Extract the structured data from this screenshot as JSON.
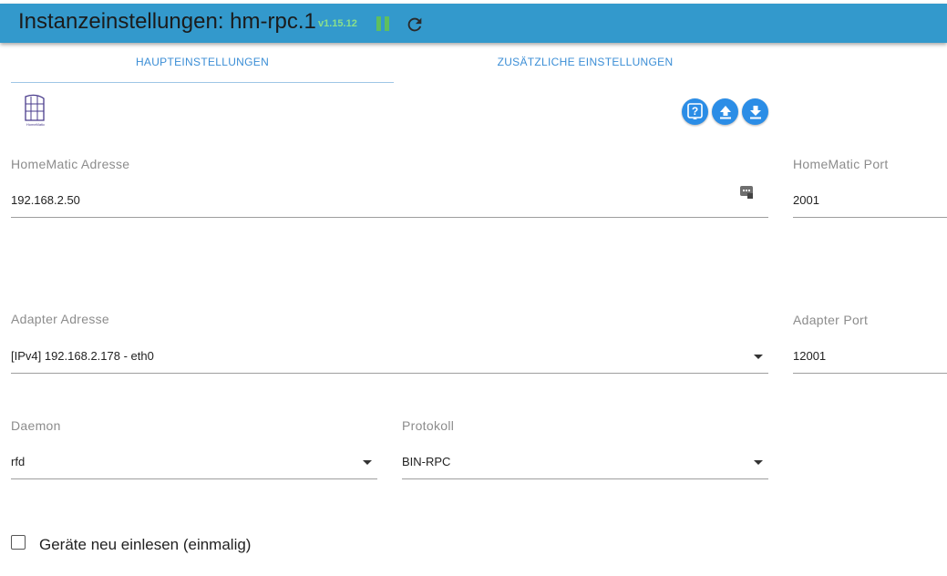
{
  "header": {
    "title": "Instanzeinstellungen: hm-rpc.1",
    "version": "v1.15.12",
    "colors": {
      "bar": "#3399cc",
      "version": "#8be08b",
      "pause": "#5fbf5f"
    }
  },
  "tabs": [
    {
      "label": "HAUPTEINSTELLUNGEN",
      "active": true
    },
    {
      "label": "ZUSÄTZLICHE EINSTELLUNGEN",
      "active": false
    }
  ],
  "logo": {
    "name": "homematic-logo",
    "text": "HomeMatic"
  },
  "actions": [
    {
      "name": "help-icon",
      "label": "?"
    },
    {
      "name": "upload-icon"
    },
    {
      "name": "download-icon"
    }
  ],
  "fields": {
    "homematic_address": {
      "label": "HomeMatic Adresse",
      "value": "192.168.2.50"
    },
    "homematic_port": {
      "label": "HomeMatic Port",
      "value": "2001"
    },
    "adapter_address": {
      "label": "Adapter Adresse",
      "value": "[IPv4] 192.168.2.178 - eth0"
    },
    "adapter_port": {
      "label": "Adapter Port",
      "value": "12001"
    },
    "daemon": {
      "label": "Daemon",
      "value": "rfd"
    },
    "protocol": {
      "label": "Protokoll",
      "value": "BIN-RPC"
    }
  },
  "checkbox": {
    "label": "Geräte neu einlesen (einmalig)",
    "checked": false
  },
  "accent_color": "#2b8de6"
}
